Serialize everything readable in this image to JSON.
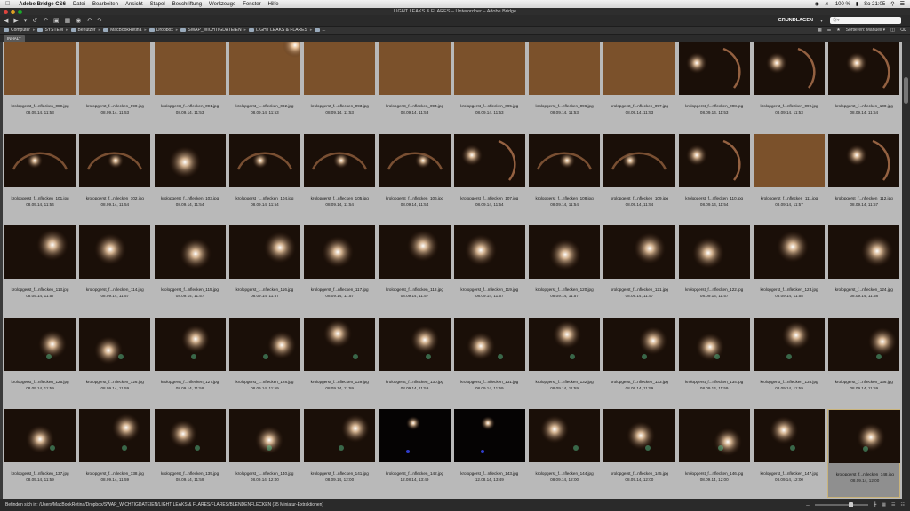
{
  "menubar": {
    "app": "Adobe Bridge CS6",
    "items": [
      "Datei",
      "Bearbeiten",
      "Ansicht",
      "Stapel",
      "Beschriftung",
      "Werkzeuge",
      "Fenster",
      "Hilfe"
    ],
    "battery": "100 %",
    "clock": "So 21:05"
  },
  "window": {
    "title": "LIGHT LEAKS & FLARES – Unterordner – Adobe Bridge"
  },
  "toolbar": {
    "workspace": "GRUNDLAGEN",
    "search_placeholder": "Ⓠ▾"
  },
  "path": {
    "crumbs": [
      "Computer",
      "SYSTEM",
      "Benutzer",
      "MacBookRetina",
      "Dropbox",
      "SWAP_WICHTIGDATEIEN",
      "LIGHT LEAKS & FLARES"
    ],
    "more": "...",
    "sort_label": "Sortieren: Manuell ▾"
  },
  "tab": {
    "label": "INHALT"
  },
  "status": {
    "text": "Befinden sich in: /Users/MacBookRetina/Dropbox/SWAP_WICHTIGDATEIEN/LIGHT LEAKS & FLARES/FLARES/BLENDENFLECKEN (35 Miniatur-Extraktionen)"
  },
  "thumbnails": [
    {
      "name": "krolopgerst_f...nflecken_089.jpg",
      "date": "08.09.14, 11:53",
      "style": "leak"
    },
    {
      "name": "krolopgerst_f...nflecken_090.jpg",
      "date": "08.09.14, 11:53",
      "style": "leak"
    },
    {
      "name": "krolopgerst_f...nflecken_091.jpg",
      "date": "08.09.14, 11:53",
      "style": "leak"
    },
    {
      "name": "krolopgerst_f...nflecken_092.jpg",
      "date": "08.09.14, 11:53",
      "style": "leak-corner"
    },
    {
      "name": "krolopgerst_f...nflecken_093.jpg",
      "date": "08.09.14, 11:53",
      "style": "leak"
    },
    {
      "name": "krolopgerst_f...nflecken_094.jpg",
      "date": "08.09.14, 11:53",
      "style": "leak"
    },
    {
      "name": "krolopgerst_f...nflecken_095.jpg",
      "date": "08.09.14, 11:53",
      "style": "leak"
    },
    {
      "name": "krolopgerst_f...nflecken_096.jpg",
      "date": "08.09.14, 11:53",
      "style": "leak"
    },
    {
      "name": "krolopgerst_f...nflecken_097.jpg",
      "date": "08.09.14, 11:53",
      "style": "leak"
    },
    {
      "name": "krolopgerst_f...nflecken_098.jpg",
      "date": "08.09.14, 11:53",
      "style": "ring"
    },
    {
      "name": "krolopgerst_f...nflecken_099.jpg",
      "date": "08.09.14, 11:53",
      "style": "ring"
    },
    {
      "name": "krolopgerst_f...nflecken_100.jpg",
      "date": "08.09.14, 11:54",
      "style": "ring"
    },
    {
      "name": "krolopgerst_f...nflecken_101.jpg",
      "date": "08.09.14, 11:54",
      "style": "arc"
    },
    {
      "name": "krolopgerst_f...nflecken_102.jpg",
      "date": "08.09.14, 11:54",
      "style": "arc"
    },
    {
      "name": "krolopgerst_f...nflecken_103.jpg",
      "date": "08.09.14, 11:54",
      "style": "spot"
    },
    {
      "name": "krolopgerst_f...nflecken_104.jpg",
      "date": "08.09.14, 11:54",
      "style": "arc"
    },
    {
      "name": "krolopgerst_f...nflecken_105.jpg",
      "date": "08.09.14, 11:54",
      "style": "arc"
    },
    {
      "name": "krolopgerst_f...nflecken_106.jpg",
      "date": "08.09.14, 11:54",
      "style": "arc"
    },
    {
      "name": "krolopgerst_f...nflecken_107.jpg",
      "date": "08.09.14, 11:54",
      "style": "ring"
    },
    {
      "name": "krolopgerst_f...nflecken_108.jpg",
      "date": "08.09.14, 11:54",
      "style": "arc"
    },
    {
      "name": "krolopgerst_f...nflecken_109.jpg",
      "date": "08.09.14, 11:54",
      "style": "arc"
    },
    {
      "name": "krolopgerst_f...nflecken_110.jpg",
      "date": "08.09.14, 11:54",
      "style": "ring"
    },
    {
      "name": "krolopgerst_f...nflecken_111.jpg",
      "date": "08.09.14, 11:57",
      "style": "leak"
    },
    {
      "name": "krolopgerst_f...nflecken_112.jpg",
      "date": "08.09.14, 11:57",
      "style": "ring"
    },
    {
      "name": "krolopgerst_f...nflecken_113.jpg",
      "date": "08.09.14, 11:57",
      "style": "spot"
    },
    {
      "name": "krolopgerst_f...nflecken_114.jpg",
      "date": "08.09.14, 11:57",
      "style": "spot"
    },
    {
      "name": "krolopgerst_f...nflecken_115.jpg",
      "date": "08.09.14, 11:57",
      "style": "spot"
    },
    {
      "name": "krolopgerst_f...nflecken_116.jpg",
      "date": "08.09.14, 11:57",
      "style": "spot"
    },
    {
      "name": "krolopgerst_f...nflecken_117.jpg",
      "date": "08.09.14, 11:57",
      "style": "spot"
    },
    {
      "name": "krolopgerst_f...nflecken_118.jpg",
      "date": "08.09.14, 11:57",
      "style": "spot"
    },
    {
      "name": "krolopgerst_f...nflecken_119.jpg",
      "date": "08.09.14, 11:57",
      "style": "spot"
    },
    {
      "name": "krolopgerst_f...nflecken_120.jpg",
      "date": "08.09.14, 11:57",
      "style": "spot"
    },
    {
      "name": "krolopgerst_f...nflecken_121.jpg",
      "date": "08.09.14, 11:57",
      "style": "spot"
    },
    {
      "name": "krolopgerst_f...nflecken_122.jpg",
      "date": "08.09.14, 11:57",
      "style": "spot"
    },
    {
      "name": "krolopgerst_f...nflecken_123.jpg",
      "date": "08.09.14, 11:58",
      "style": "spot"
    },
    {
      "name": "krolopgerst_f...nflecken_124.jpg",
      "date": "08.09.14, 11:58",
      "style": "spot"
    },
    {
      "name": "krolopgerst_f...nflecken_125.jpg",
      "date": "08.09.14, 11:59",
      "style": "bright"
    },
    {
      "name": "krolopgerst_f...nflecken_126.jpg",
      "date": "08.09.14, 11:59",
      "style": "bright"
    },
    {
      "name": "krolopgerst_f...nflecken_127.jpg",
      "date": "08.09.14, 11:59",
      "style": "bright"
    },
    {
      "name": "krolopgerst_f...nflecken_128.jpg",
      "date": "08.09.14, 11:59",
      "style": "bright"
    },
    {
      "name": "krolopgerst_f...nflecken_129.jpg",
      "date": "08.09.14, 11:59",
      "style": "bright"
    },
    {
      "name": "krolopgerst_f...nflecken_130.jpg",
      "date": "08.09.14, 11:59",
      "style": "bright"
    },
    {
      "name": "krolopgerst_f...nflecken_131.jpg",
      "date": "08.09.14, 11:59",
      "style": "bright"
    },
    {
      "name": "krolopgerst_f...nflecken_132.jpg",
      "date": "08.09.14, 11:59",
      "style": "bright"
    },
    {
      "name": "krolopgerst_f...nflecken_133.jpg",
      "date": "08.09.14, 11:59",
      "style": "bright"
    },
    {
      "name": "krolopgerst_f...nflecken_134.jpg",
      "date": "08.09.14, 11:59",
      "style": "bright"
    },
    {
      "name": "krolopgerst_f...nflecken_135.jpg",
      "date": "08.09.14, 11:59",
      "style": "bright"
    },
    {
      "name": "krolopgerst_f...nflecken_136.jpg",
      "date": "08.09.14, 11:59",
      "style": "bright"
    },
    {
      "name": "krolopgerst_f...nflecken_137.jpg",
      "date": "08.09.14, 11:59",
      "style": "bright"
    },
    {
      "name": "krolopgerst_f...nflecken_138.jpg",
      "date": "08.09.14, 11:59",
      "style": "bright"
    },
    {
      "name": "krolopgerst_f...nflecken_139.jpg",
      "date": "08.09.14, 11:59",
      "style": "bright"
    },
    {
      "name": "krolopgerst_f...nflecken_140.jpg",
      "date": "08.09.14, 12:00",
      "style": "bright"
    },
    {
      "name": "krolopgerst_f...nflecken_141.jpg",
      "date": "08.09.14, 12:00",
      "style": "bright"
    },
    {
      "name": "krolopgerst_f...nflecken_142.jpg",
      "date": "12.08.14, 13:49",
      "style": "dark"
    },
    {
      "name": "krolopgerst_f...nflecken_143.jpg",
      "date": "12.08.14, 13:49",
      "style": "dark"
    },
    {
      "name": "krolopgerst_f...nflecken_144.jpg",
      "date": "08.09.14, 12:00",
      "style": "bright"
    },
    {
      "name": "krolopgerst_f...nflecken_145.jpg",
      "date": "08.09.14, 12:00",
      "style": "bright"
    },
    {
      "name": "krolopgerst_f...nflecken_146.jpg",
      "date": "08.09.14, 12:00",
      "style": "bright"
    },
    {
      "name": "krolopgerst_f...nflecken_147.jpg",
      "date": "08.09.14, 12:00",
      "style": "bright"
    },
    {
      "name": "krolopgerst_f...nflecken_148.jpg",
      "date": "08.09.14, 12:00",
      "style": "bright",
      "selected": true
    }
  ]
}
